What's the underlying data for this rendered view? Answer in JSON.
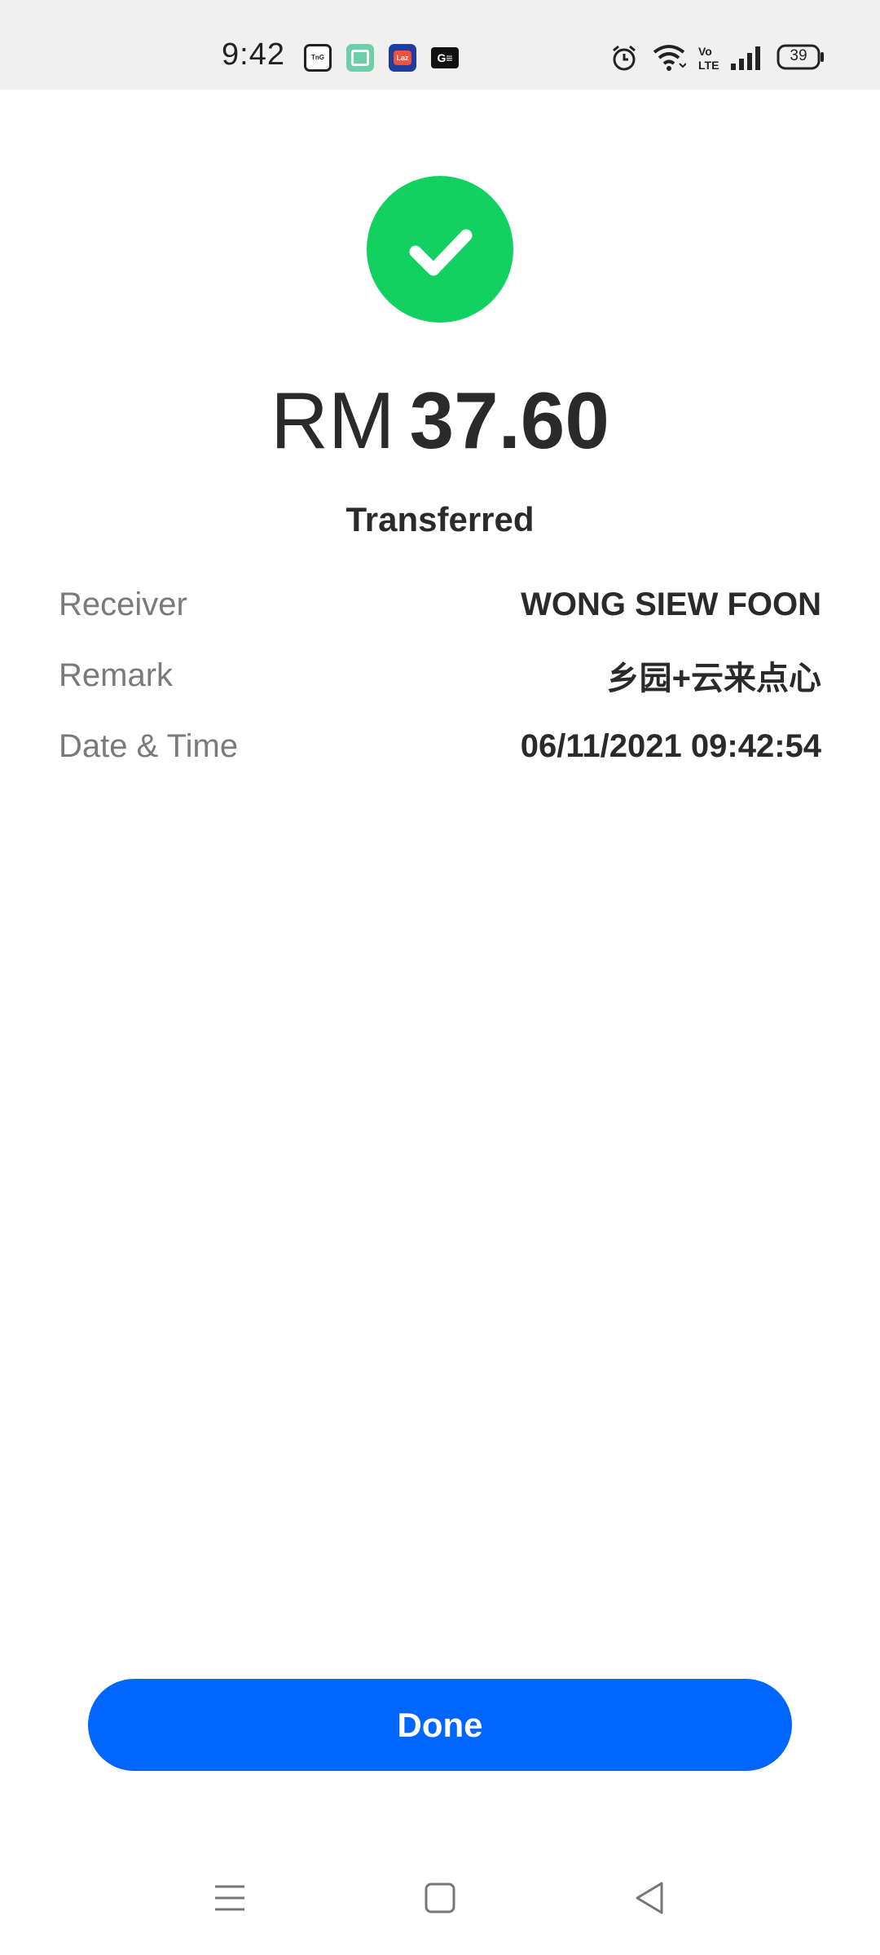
{
  "status_bar": {
    "time": "9:42",
    "battery_level": "39",
    "notification_icons": [
      "touch-n-go-ewallet-icon",
      "green-app-icon",
      "lazada-icon",
      "gopay-icon"
    ],
    "system_icons": [
      "alarm-icon",
      "wifi-icon",
      "volte-icon",
      "signal-icon",
      "battery-icon"
    ]
  },
  "receipt": {
    "status_icon": "checkmark-icon",
    "currency": "RM",
    "amount": "37.60",
    "status": "Transferred",
    "details": {
      "receiver_label": "Receiver",
      "receiver_value": "WONG SIEW FOON",
      "remark_label": "Remark",
      "remark_value": "乡园+云来点心",
      "datetime_label": "Date & Time",
      "datetime_value": "06/11/2021 09:42:54"
    }
  },
  "actions": {
    "done_label": "Done"
  },
  "colors": {
    "success_green": "#12d160",
    "primary_blue": "#0066ff",
    "text_dark": "#2a2a2a",
    "text_muted": "#7a7a7a",
    "status_bar_bg": "#f0f0f0"
  },
  "nav_bar": {
    "buttons": [
      "menu-icon",
      "home-icon",
      "back-icon"
    ]
  }
}
